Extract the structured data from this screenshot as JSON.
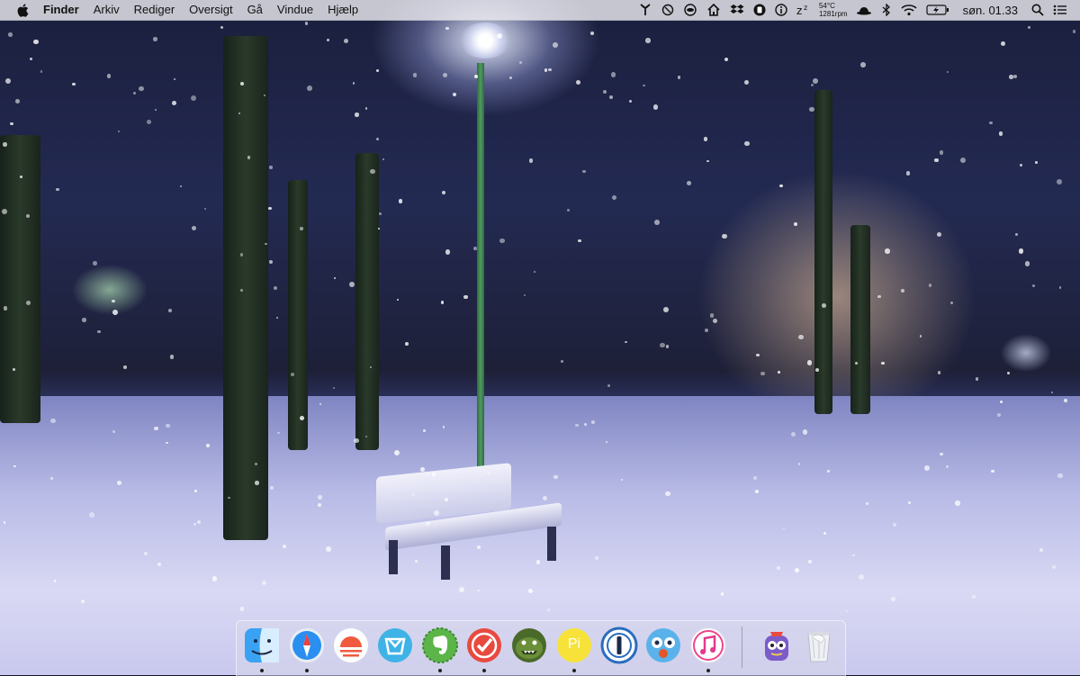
{
  "menubar": {
    "app_name": "Finder",
    "menus": [
      "Arkiv",
      "Rediger",
      "Oversigt",
      "Gå",
      "Vindue",
      "Hjælp"
    ],
    "tray": {
      "temperature": "54°C",
      "fan_speed": "1281rpm",
      "clock": "søn. 01.33"
    }
  },
  "dock": {
    "apps": [
      {
        "name": "Finder",
        "icon": "finder-icon",
        "running": true
      },
      {
        "name": "Safari",
        "icon": "safari-icon",
        "running": true
      },
      {
        "name": "Sunrise",
        "icon": "sunrise-icon",
        "running": false
      },
      {
        "name": "Mailbox",
        "icon": "mailbox-icon",
        "running": false
      },
      {
        "name": "Evernote",
        "icon": "evernote-icon",
        "running": true
      },
      {
        "name": "Wunderlist",
        "icon": "wunderlist-icon",
        "running": true
      },
      {
        "name": "Ears",
        "icon": "monster-icon",
        "running": false
      },
      {
        "name": "Pi",
        "icon": "pi-icon",
        "running": true
      },
      {
        "name": "1Password",
        "icon": "1password-icon",
        "running": false
      },
      {
        "name": "Tweetbot",
        "icon": "tweetbot-icon",
        "running": false
      },
      {
        "name": "iTunes",
        "icon": "itunes-icon",
        "running": true
      }
    ],
    "extras": [
      {
        "name": "Monster",
        "icon": "robot-icon"
      },
      {
        "name": "Trash",
        "icon": "trash-icon"
      }
    ],
    "pi_label": "Pi"
  },
  "colors": {
    "menubar_bg": "#ececf0",
    "dock_bg": "#d7d7eb",
    "snow": "#ffffff",
    "lamp_green": "#4f9a5f"
  }
}
